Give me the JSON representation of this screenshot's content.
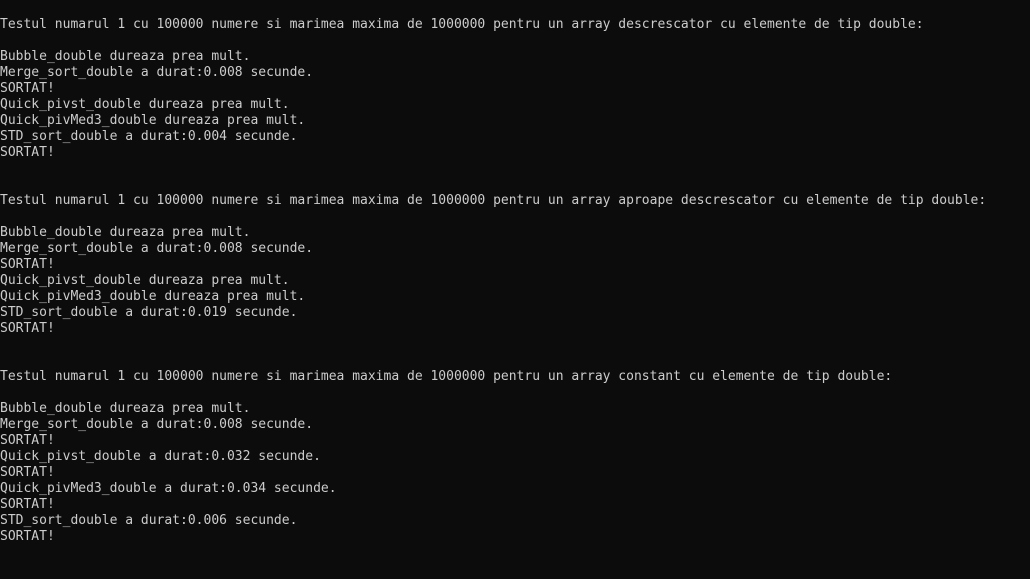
{
  "console": {
    "lines": [
      "Testul numarul 1 cu 100000 numere si marimea maxima de 1000000 pentru un array descrescator cu elemente de tip double:",
      "",
      "Bubble_double dureaza prea mult.",
      "Merge_sort_double a durat:0.008 secunde.",
      "SORTAT!",
      "Quick_pivst_double dureaza prea mult.",
      "Quick_pivMed3_double dureaza prea mult.",
      "STD_sort_double a durat:0.004 secunde.",
      "SORTAT!",
      "",
      "",
      "Testul numarul 1 cu 100000 numere si marimea maxima de 1000000 pentru un array aproape descrescator cu elemente de tip double:",
      "",
      "Bubble_double dureaza prea mult.",
      "Merge_sort_double a durat:0.008 secunde.",
      "SORTAT!",
      "Quick_pivst_double dureaza prea mult.",
      "Quick_pivMed3_double dureaza prea mult.",
      "STD_sort_double a durat:0.019 secunde.",
      "SORTAT!",
      "",
      "",
      "Testul numarul 1 cu 100000 numere si marimea maxima de 1000000 pentru un array constant cu elemente de tip double:",
      "",
      "Bubble_double dureaza prea mult.",
      "Merge_sort_double a durat:0.008 secunde.",
      "SORTAT!",
      "Quick_pivst_double a durat:0.032 secunde.",
      "SORTAT!",
      "Quick_pivMed3_double a durat:0.034 secunde.",
      "SORTAT!",
      "STD_sort_double a durat:0.006 secunde.",
      "SORTAT!"
    ]
  }
}
